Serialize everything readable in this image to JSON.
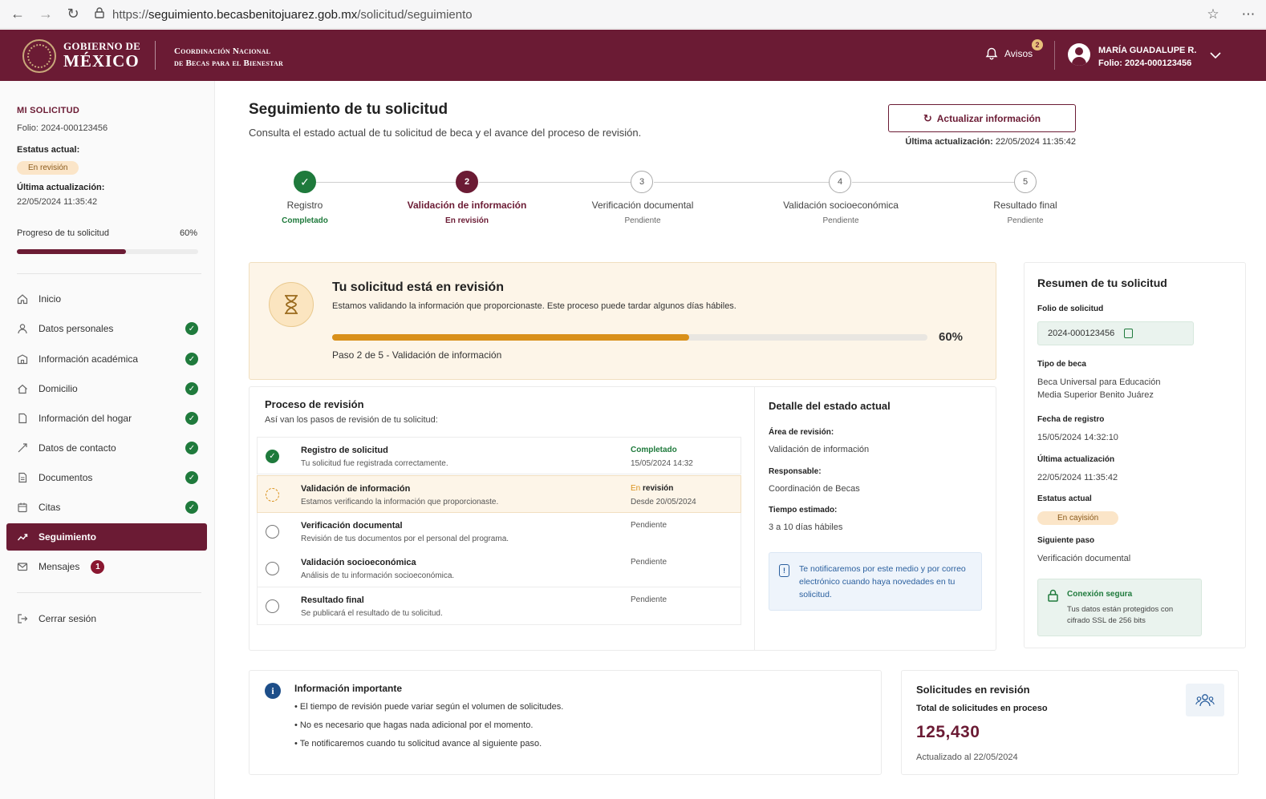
{
  "browser": {
    "url_prefix": "https://",
    "url_host": "seguimiento.becasbenitojuarez.gob.mx",
    "url_path": "/solicitud/seguimiento"
  },
  "header": {
    "gov_line1": "GOBIERNO DE",
    "gov_line2": "MÉXICO",
    "coord_line1": "Coordinación Nacional",
    "coord_line2": "de Becas para el Bienestar",
    "avisos_label": "Avisos",
    "avisos_count": "2",
    "user_name": "MARÍA GUADALUPE R.",
    "user_folio": "Folio: 2024-000123456"
  },
  "sidebar": {
    "title": "MI SOLICITUD",
    "folio": "Folio: 2024-000123456",
    "status_label": "Estatus actual:",
    "status_value": "En revisión",
    "updated_label": "Última actualización:",
    "updated_value": "22/05/2024 11:35:42",
    "progress_label": "Progreso de tu solicitud",
    "progress_pct": "60%",
    "progress_value": 0.6,
    "items": [
      {
        "label": "Inicio",
        "icon": "home-icon",
        "done": false
      },
      {
        "label": "Datos personales",
        "icon": "user-icon",
        "done": true
      },
      {
        "label": "Información académica",
        "icon": "school-icon",
        "done": true
      },
      {
        "label": "Domicilio",
        "icon": "house-icon",
        "done": true
      },
      {
        "label": "Información del hogar",
        "icon": "document-icon",
        "done": true
      },
      {
        "label": "Datos de contacto",
        "icon": "contact-icon",
        "done": true
      },
      {
        "label": "Documentos",
        "icon": "files-icon",
        "done": true
      },
      {
        "label": "Citas",
        "icon": "calendar-icon",
        "done": true
      },
      {
        "label": "Seguimiento",
        "icon": "tracking-icon",
        "active": true
      },
      {
        "label": "Mensajes",
        "icon": "mail-icon",
        "badge": "1"
      }
    ],
    "logout_label": "Cerrar sesión"
  },
  "main": {
    "title": "Seguimiento de tu solicitud",
    "subtitle": "Consulta el estado actual de tu solicitud de beca y el avance del proceso de revisión.",
    "refresh_label": "Actualizar información",
    "last_updated_label": "Última actualización:",
    "last_updated_value": "22/05/2024 11:35:42"
  },
  "stepper": [
    {
      "number": "✓",
      "label": "Registro",
      "status": "Completado",
      "state": "done"
    },
    {
      "number": "2",
      "label": "Validación de información",
      "status": "En revisión",
      "state": "current"
    },
    {
      "number": "3",
      "label": "Verificación documental",
      "status": "Pendiente",
      "state": "pending"
    },
    {
      "number": "4",
      "label": "Validación socioeconómica",
      "status": "Pendiente",
      "state": "pending"
    },
    {
      "number": "5",
      "label": "Resultado final",
      "status": "Pendiente",
      "state": "pending"
    }
  ],
  "banner": {
    "title": "Tu solicitud está en revisión",
    "text": "Estamos validando la información que proporcionaste. Este proceso puede tardar algunos días hábiles.",
    "progress_pct": "60%",
    "progress_value": 0.6,
    "step_text": "Paso 2 de 5 - Validación de información"
  },
  "process": {
    "title": "Proceso de revisión",
    "subtitle": "Así van los pasos de revisión de tu solicitud:",
    "rows": [
      {
        "name": "Registro de solicitud",
        "desc": "Tu solicitud fue registrada correctamente.",
        "status": "Completado",
        "date": "15/05/2024 14:32",
        "state": "done"
      },
      {
        "name": "Validación de información",
        "desc": "Estamos verificando la información que proporcionaste.",
        "status_prefix": "En",
        "status": "revisión",
        "date": "Desde 20/05/2024",
        "state": "active"
      },
      {
        "name": "Verificación documental",
        "desc": "Revisión de tus documentos por el personal del programa.",
        "status": "Pendiente",
        "date": "",
        "state": "pending"
      },
      {
        "name": "Validación socioeconómica",
        "desc": "Análisis de tu información socioeconómica.",
        "status": "Pendiente",
        "date": "",
        "state": "pending"
      },
      {
        "name": "Resultado final",
        "desc": "Se publicará el resultado de tu solicitud.",
        "status": "Pendiente",
        "date": "",
        "state": "pending"
      }
    ]
  },
  "detail": {
    "title": "Detalle del estado actual",
    "area_label": "Área de revisión:",
    "area_value": "Validación de información",
    "resp_label": "Responsable:",
    "resp_value": "Coordinación de Becas",
    "time_label": "Tiempo estimado:",
    "time_value": "3 a 10 días hábiles",
    "notify_text": "Te notificaremos por este medio y por correo electrónico cuando haya novedades en tu solicitud."
  },
  "summary": {
    "title": "Resumen de tu solicitud",
    "folio_label": "Folio de solicitud",
    "folio_value": "2024-000123456",
    "tipo_label": "Tipo de beca",
    "tipo_value_1": "Beca Universal para Educación",
    "tipo_value_2": "Media Superior Benito Juárez",
    "fecha_label": "Fecha de registro",
    "fecha_value": "15/05/2024 14:32:10",
    "upd_label": "Última actualización",
    "upd_value": "22/05/2024 11:35:42",
    "status_label": "Estatus actual",
    "status_value": "En cayisión",
    "next_label": "Siguiente paso",
    "next_value": "Verificación documental",
    "secure_title": "Conexión segura",
    "secure_text": "Tus datos están protegidos con cifrado SSL de 256 bits"
  },
  "info": {
    "title": "Información importante",
    "bullets": [
      "• El tiempo de revisión puede variar según el volumen de solicitudes.",
      "• No es necesario que hagas nada adicional por el momento.",
      "• Te notificaremos cuando tu solicitud avance al siguiente paso."
    ]
  },
  "stats": {
    "title": "Solicitudes en revisión",
    "label": "Total de solicitudes en proceso",
    "value": "125,430",
    "updated": "Actualizado al 22/05/2024"
  },
  "colors": {
    "brand": "#6b1b34",
    "success": "#1f7a3c",
    "warning": "#d9901a",
    "info": "#2a5f9e"
  }
}
